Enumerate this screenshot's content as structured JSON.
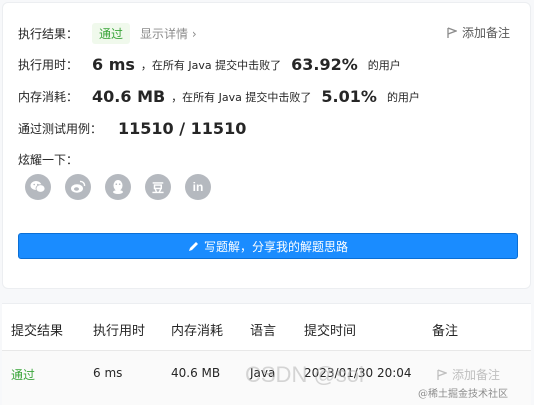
{
  "result": {
    "label": "执行结果：",
    "status": "通过",
    "details_link": "显示详情 ›",
    "add_note": "添加备注"
  },
  "runtime": {
    "label": "执行用时：",
    "value": "6 ms",
    "beat_text": "，在所有 Java 提交中击败了",
    "percent": "63.92%",
    "suffix": "的用户"
  },
  "memory": {
    "label": "内存消耗：",
    "value": "40.6 MB",
    "beat_text": "，在所有 Java 提交中击败了",
    "percent": "5.01%",
    "suffix": "的用户"
  },
  "tests": {
    "label": "通过测试用例：",
    "value": "11510 / 11510"
  },
  "share": {
    "label": "炫耀一下：",
    "icons": [
      "wechat-icon",
      "weibo-icon",
      "qq-icon",
      "douban-icon",
      "linkedin-icon"
    ],
    "douban_text": "豆",
    "linkedin_text": "in"
  },
  "write_button": {
    "label": "写题解，分享我的解题思路"
  },
  "table": {
    "headers": [
      "提交结果",
      "执行用时",
      "内存消耗",
      "语言",
      "提交时间",
      "备注"
    ],
    "row": {
      "status": "通过",
      "runtime": "6 ms",
      "memory": "40.6 MB",
      "language": "Java",
      "time": "2023/01/30 20:04",
      "note": "添加备注"
    }
  },
  "watermarks": {
    "csdn": "CSDN @sol",
    "juejin": "@稀土掘金技术社区"
  },
  "colors": {
    "accent": "#1a8cff",
    "success": "#3aa53a",
    "icon_gray": "#b5b9bf"
  }
}
